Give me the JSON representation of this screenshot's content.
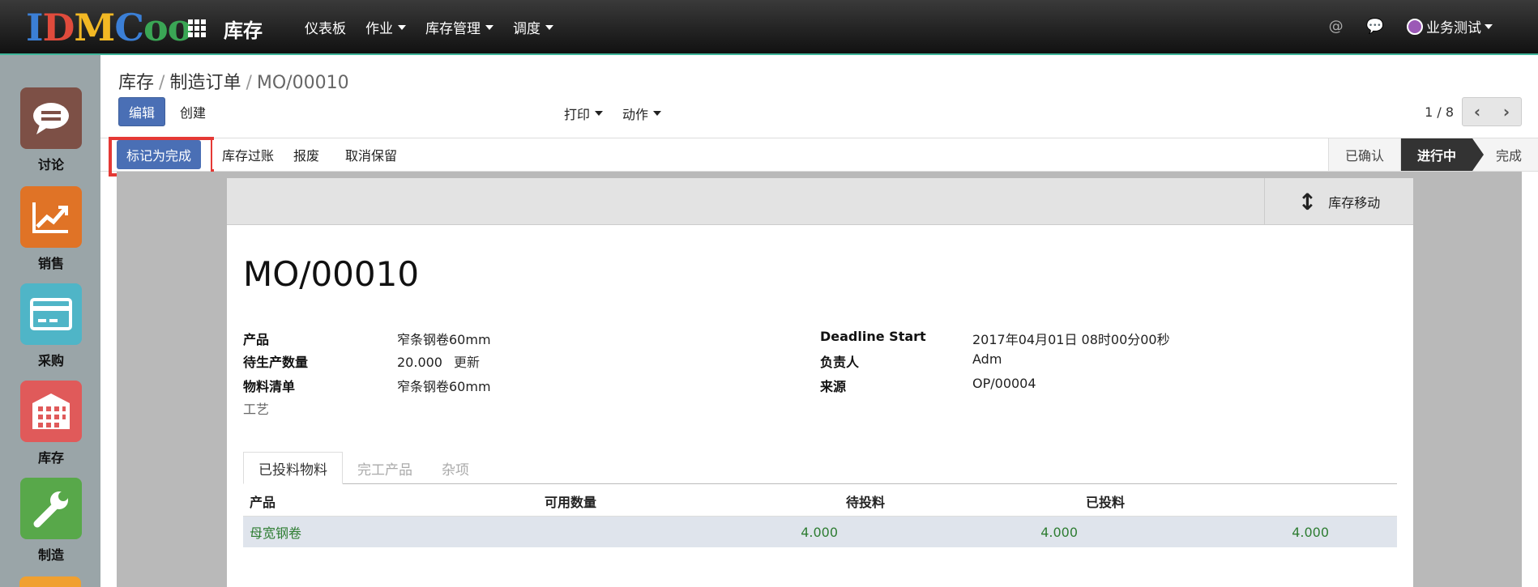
{
  "topbar": {
    "logo": [
      "I",
      "D",
      "M",
      "C",
      "o",
      "o"
    ],
    "app_title": "库存",
    "nav": [
      "仪表板",
      "作业",
      "库存管理",
      "调度"
    ],
    "icons": {
      "mention": "@",
      "chat": "💬"
    },
    "user_name": "业务测试"
  },
  "sidebar": {
    "items": [
      {
        "label": "讨论",
        "color": "#8a5a4d",
        "icon": "chat-bubble-icon"
      },
      {
        "label": "销售",
        "color": "#e07326",
        "icon": "chart-icon"
      },
      {
        "label": "采购",
        "color": "#4fb5c7",
        "icon": "credit-card-icon"
      },
      {
        "label": "库存",
        "color": "#e05a5a",
        "icon": "building-icon"
      },
      {
        "label": "制造",
        "color": "#58a84a",
        "icon": "wrench-icon"
      }
    ]
  },
  "breadcrumb": {
    "root": "库存",
    "parent": "制造订单",
    "current": "MO/00010"
  },
  "toolbar": {
    "edit": "编辑",
    "create": "创建",
    "print": "打印",
    "action": "动作"
  },
  "pager": {
    "text": "1 / 8"
  },
  "status_buttons": {
    "mark_done": "标记为完成",
    "post_inventory": "库存过账",
    "scrap": "报废",
    "unreserve": "取消保留"
  },
  "stages": [
    "已确认",
    "进行中",
    "完成"
  ],
  "smart_button": {
    "label": "库存移动"
  },
  "record": {
    "name": "MO/00010",
    "left": [
      {
        "label": "产品",
        "value": "窄条钢卷60mm"
      },
      {
        "label": "待生产数量",
        "value": "20.000",
        "link": "更新"
      },
      {
        "label": "物料清单",
        "value": "窄条钢卷60mm"
      },
      {
        "label": "工艺",
        "value": ""
      }
    ],
    "right": [
      {
        "label": "Deadline Start",
        "value": "2017年04月01日 08时00分00秒"
      },
      {
        "label": "负责人",
        "value": "Adm"
      },
      {
        "label": "来源",
        "value": "OP/00004"
      }
    ]
  },
  "tabs": [
    "已投料物料",
    "完工产品",
    "杂项"
  ],
  "table": {
    "headers": [
      "产品",
      "可用数量",
      "待投料",
      "已投料"
    ],
    "rows": [
      [
        "母宽钢卷",
        "4.000",
        "4.000",
        "4.000"
      ]
    ]
  }
}
